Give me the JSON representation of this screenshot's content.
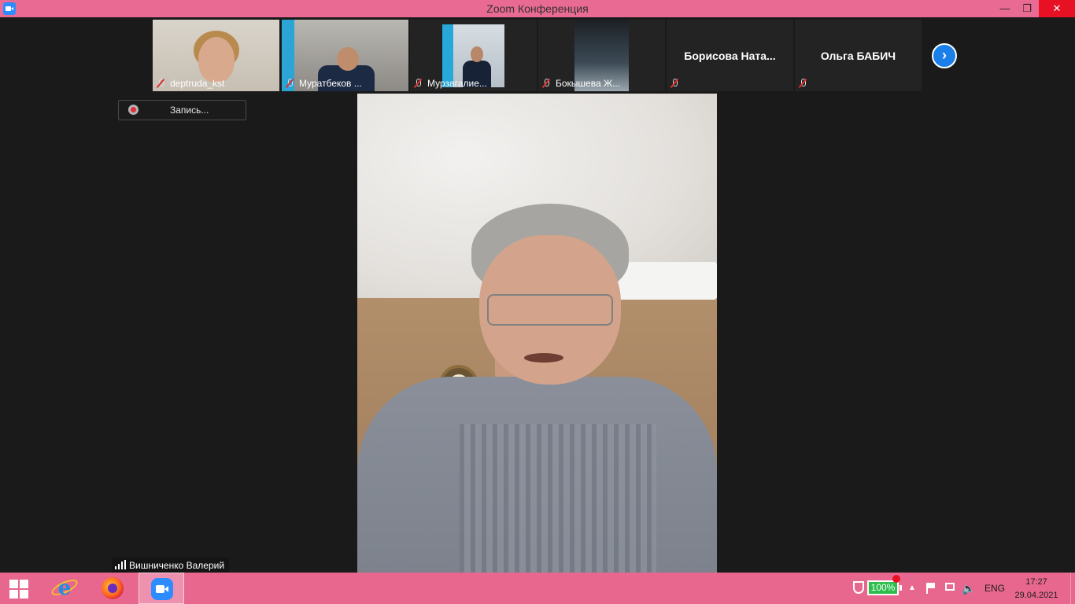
{
  "window": {
    "title": "Zoom Конференция"
  },
  "gallery": {
    "participants": [
      {
        "name": "deptruda_kst",
        "video": true
      },
      {
        "name": "Муратбеков ...",
        "video": true
      },
      {
        "name": "Мурзагалие...",
        "video": true
      },
      {
        "name": "Бокышева Ж...",
        "video": true
      },
      {
        "name": "Борисова  Ната...",
        "video": false
      },
      {
        "name": "Ольга БАБИЧ",
        "video": false
      }
    ],
    "next_icon": "chevron-right-icon"
  },
  "recording": {
    "label": "Запись..."
  },
  "main_video": {
    "speaker_name": "Вишниченко Валерий"
  },
  "taskbar": {
    "battery_percent": "100%",
    "language": "ENG",
    "time": "17:27",
    "date": "29.04.2021"
  },
  "colors": {
    "titlebar": "#e96a92",
    "taskbar": "#e8678f",
    "zoom_blue": "#2d8cff",
    "next_button": "#1a7fe8",
    "background": "#1a1a1a"
  }
}
